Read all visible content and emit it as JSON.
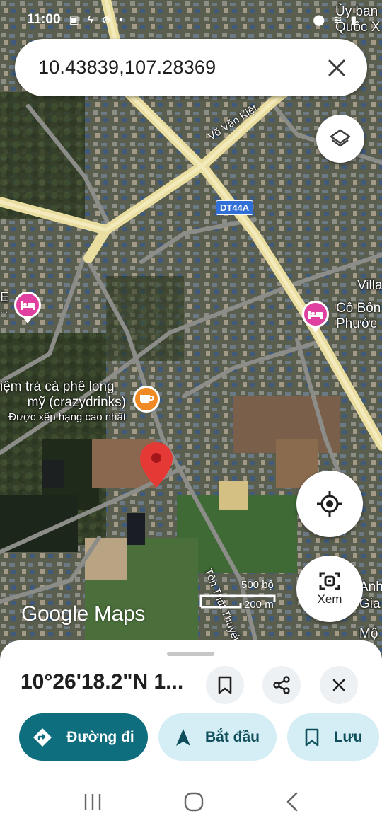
{
  "status_bar": {
    "time": "11:00"
  },
  "search": {
    "query": "10.43839,107.28369"
  },
  "map": {
    "road_labels": {
      "vo_van_kiet": "Võ Văn Kiệt",
      "ton_that_thuyet": "Tôn Thất Thuyết"
    },
    "road_shield": "DT44A",
    "places": {
      "top_right": [
        "Ủy ban",
        "Quốc X"
      ],
      "villa": "Villa",
      "hotel_right": [
        "Cô Bôn",
        "Phước"
      ],
      "hotel_left": [
        "E",
        "..."
      ],
      "cafe": [
        "iệm trà cà phê long",
        "mỹ (crazydrinks)",
        "Được xếp hạng cao nhất"
      ],
      "right_edge": [
        "Anh",
        "Gia",
        "Mộ"
      ]
    },
    "scale": {
      "imperial": "500 bộ",
      "metric": "200 m"
    },
    "logo": "Google Maps",
    "view_label": "Xem"
  },
  "sheet": {
    "title": "10°26'18.2\"N 1...",
    "actions": {
      "directions": "Đường đi",
      "start": "Bắt đầu",
      "save": "Lưu"
    }
  },
  "colors": {
    "accent": "#0f6e7e",
    "pin": "#e53935",
    "hotel": "#e040a0",
    "cafe": "#f08a24",
    "road": "#f3e7a6"
  },
  "icons": [
    "layers-icon",
    "my-location-icon",
    "lens-icon",
    "bookmark-icon",
    "share-icon",
    "close-icon",
    "directions-icon",
    "navigation-icon",
    "home-icon",
    "back-icon",
    "recents-icon"
  ]
}
